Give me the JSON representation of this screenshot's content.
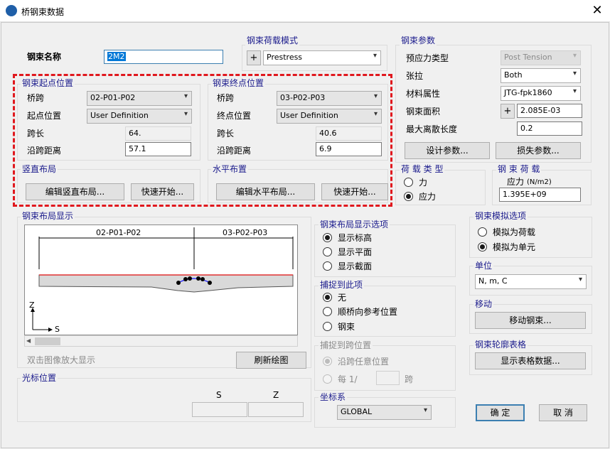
{
  "window": {
    "title": "桥钢束数据",
    "close_icon": "close-icon"
  },
  "tendon_name": {
    "label": "钢束名称",
    "value": "2M2"
  },
  "load_mode": {
    "label": "钢束荷载模式",
    "value": "Prestress"
  },
  "start_pos": {
    "label": "钢束起点位置",
    "span_label": "桥跨",
    "span_value": "02-P01-P02",
    "pos_label": "起点位置",
    "pos_value": "User Definition",
    "length_label": "跨长",
    "length_value": "64.",
    "dist_label": "沿跨距离",
    "dist_value": "57.1"
  },
  "end_pos": {
    "label": "钢束终点位置",
    "span_label": "桥跨",
    "span_value": "03-P02-P03",
    "pos_label": "终点位置",
    "pos_value": "User Definition",
    "length_label": "跨长",
    "length_value": "40.6",
    "dist_label": "沿跨距离",
    "dist_value": "6.9"
  },
  "vertical": {
    "label": "竖直布局",
    "edit_button": "编辑竖直布局...",
    "quick_button": "快速开始..."
  },
  "horizontal": {
    "label": "水平布置",
    "edit_button": "编辑水平布局...",
    "quick_button": "快速开始..."
  },
  "params": {
    "label": "钢束参数",
    "type_label": "预应力类型",
    "type_value": "Post Tension",
    "tension_label": "张拉",
    "tension_value": "Both",
    "material_label": "材料属性",
    "material_value": "JTG-fpk1860",
    "area_label": "钢束面积",
    "area_value": "2.085E-03",
    "discretization_label": "最大离散长度",
    "discretization_value": "0.2",
    "design_button": "设计参数...",
    "loss_button": "损失参数..."
  },
  "load_type": {
    "label": "荷 载 类 型",
    "force": "力",
    "stress": "应力"
  },
  "tendon_load": {
    "label": "钢 束 荷 载",
    "unit_label": "应力",
    "unit": "(N/m2)",
    "value": "1.395E+09"
  },
  "layout_display": {
    "label": "钢束布局显示",
    "span1": "02-P01-P02",
    "span2": "03-P02-P03",
    "axis_z": "Z",
    "axis_s": "S",
    "zoom_hint": "双击图像放大显示",
    "refresh_button": "刷新绘图"
  },
  "cursor_pos": {
    "label": "光标位置",
    "s_label": "S",
    "z_label": "Z"
  },
  "display_options": {
    "label": "钢束布局显示选项",
    "opt1": "显示标高",
    "opt2": "显示平面",
    "opt3": "显示截面"
  },
  "snap_here": {
    "label": "捕捉到此项",
    "opt1": "无",
    "opt2": "顺桥向参考位置",
    "opt3": "钢束"
  },
  "snap_span": {
    "label": "捕捉到跨位置",
    "opt1": "沿跨任意位置",
    "opt2_prefix": "每 1/",
    "opt2_suffix": "跨"
  },
  "coord_sys": {
    "label": "坐标系",
    "value": "GLOBAL"
  },
  "sim_options": {
    "label": "钢束模拟选项",
    "opt1": "模拟为荷载",
    "opt2": "模拟为单元"
  },
  "unit": {
    "label": "单位",
    "value": "N, m, C"
  },
  "move": {
    "label": "移动",
    "button": "移动钢束..."
  },
  "profile_table": {
    "label": "钢束轮廓表格",
    "button": "显示表格数据..."
  },
  "ok_button": "确 定",
  "cancel_button": "取 消"
}
